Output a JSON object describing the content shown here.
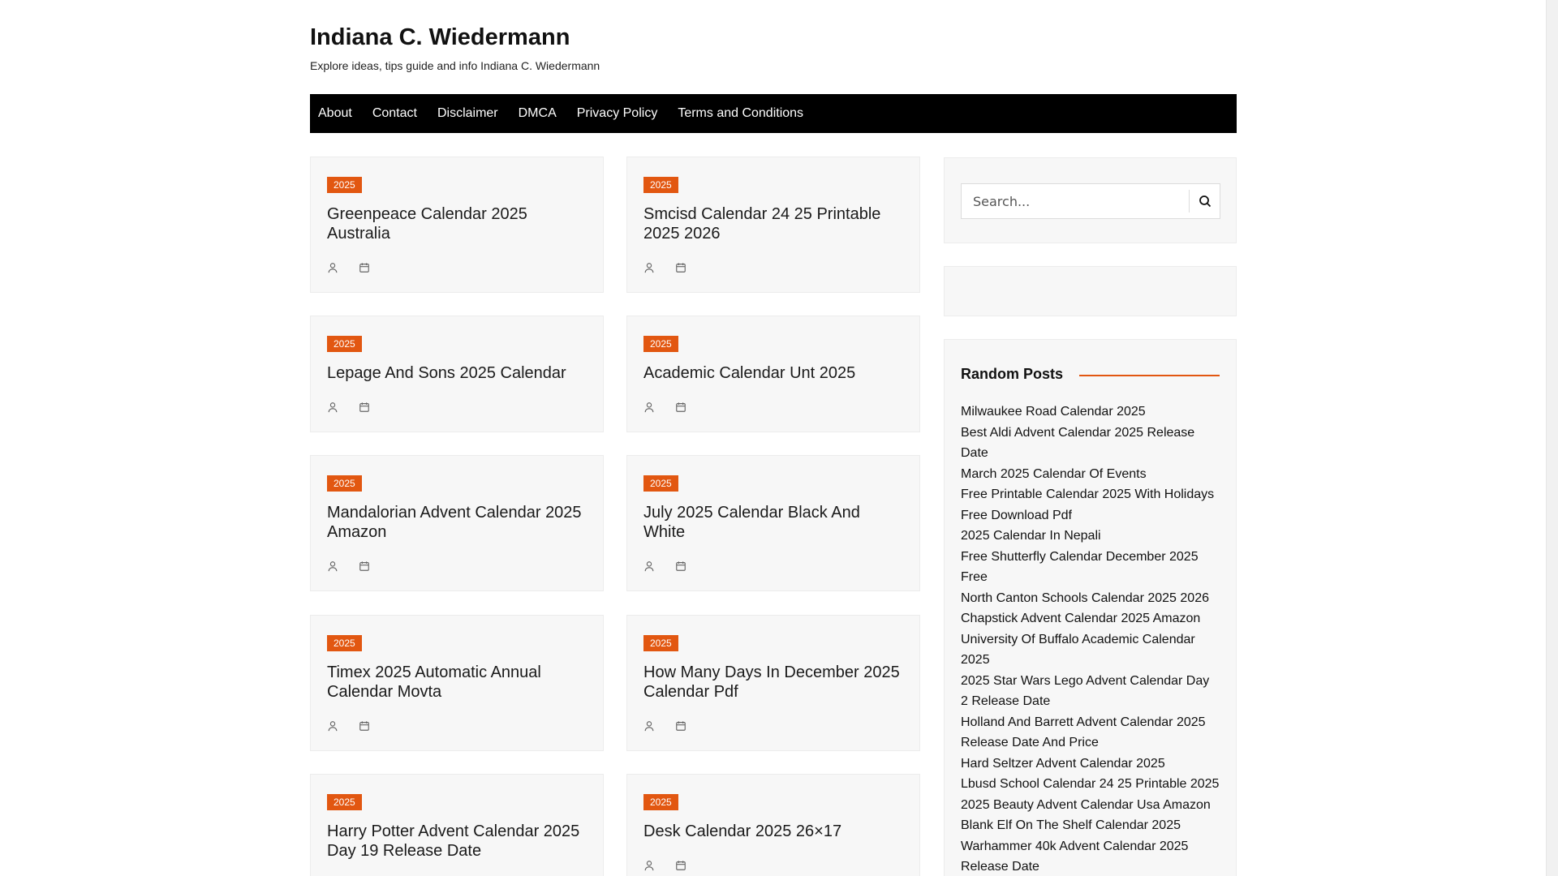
{
  "site": {
    "title": "Indiana C. Wiedermann",
    "description": "Explore ideas, tips guide and info Indiana C. Wiedermann"
  },
  "nav": [
    "About",
    "Contact",
    "Disclaimer",
    "DMCA",
    "Privacy Policy",
    "Terms and Conditions"
  ],
  "posts": [
    {
      "badge": "2025",
      "title": "Greenpeace Calendar 2025 Australia"
    },
    {
      "badge": "2025",
      "title": "Smcisd Calendar 24 25 Printable 2025 2026"
    },
    {
      "badge": "2025",
      "title": "Lepage And Sons 2025 Calendar"
    },
    {
      "badge": "2025",
      "title": "Academic Calendar Unt 2025"
    },
    {
      "badge": "2025",
      "title": "Mandalorian Advent Calendar 2025 Amazon"
    },
    {
      "badge": "2025",
      "title": "July 2025 Calendar Black And White"
    },
    {
      "badge": "2025",
      "title": "Timex 2025 Automatic Annual Calendar Movta"
    },
    {
      "badge": "2025",
      "title": "How Many Days In December 2025 Calendar Pdf"
    },
    {
      "badge": "2025",
      "title": "Harry Potter Advent Calendar 2025 Day 19 Release Date"
    },
    {
      "badge": "2025",
      "title": "Desk Calendar 2025 26×17"
    }
  ],
  "search": {
    "placeholder": "Search..."
  },
  "random_posts": {
    "title": "Random Posts",
    "items": [
      "Milwaukee Road Calendar 2025",
      "Best Aldi Advent Calendar 2025 Release Date",
      "March 2025 Calendar Of Events",
      "Free Printable Calendar 2025 With Holidays Free Download Pdf",
      "2025 Calendar In Nepali",
      "Free Shutterfly Calendar December 2025 Free",
      "North Canton Schools Calendar 2025 2026",
      "Chapstick Advent Calendar 2025 Amazon",
      "University Of Buffalo Academic Calendar 2025",
      "2025 Star Wars Lego Advent Calendar Day 2 Release Date",
      "Holland And Barrett Advent Calendar 2025 Release Date And Price",
      "Hard Seltzer Advent Calendar 2025",
      "Lbusd School Calendar 24 25 Printable 2025",
      "2025 Beauty Advent Calendar Usa Amazon",
      "Blank Elf On The Shelf Calendar 2025",
      "Warhammer 40k Advent Calendar 2025 Release Date"
    ]
  },
  "colors": {
    "accent": "#e25711",
    "nav_bg": "#000000",
    "card_bg": "#f7f7f7"
  }
}
